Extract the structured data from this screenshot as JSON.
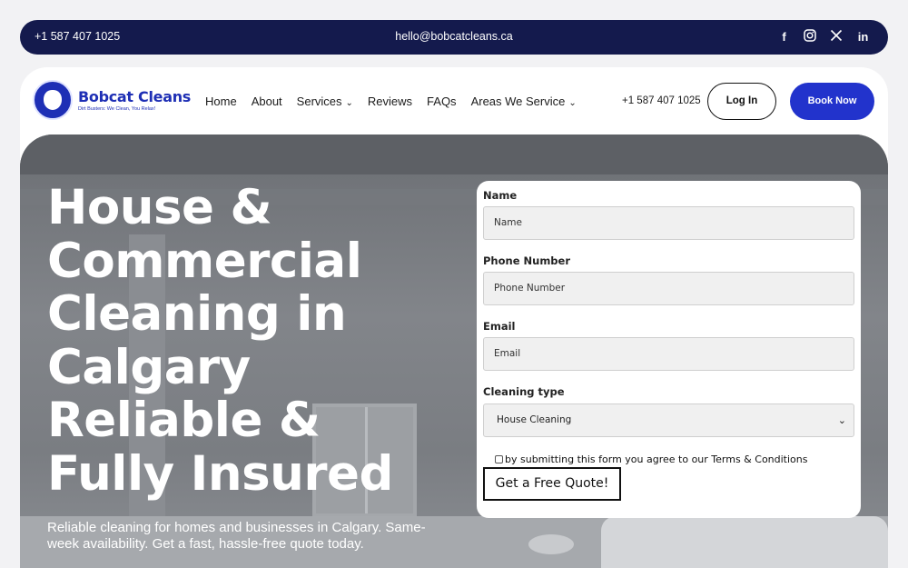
{
  "topbar": {
    "phone": "+1 587 407 1025",
    "email": "hello@bobcatcleans.ca",
    "social": [
      "facebook-icon",
      "instagram-icon",
      "x-icon",
      "linkedin-icon"
    ]
  },
  "header": {
    "logo_name": "Bobcat Cleans",
    "logo_tagline": "Dirt Busters: We Clean, You Relax!",
    "nav": [
      {
        "label": "Home",
        "dropdown": false
      },
      {
        "label": "About",
        "dropdown": false
      },
      {
        "label": "Services",
        "dropdown": true
      },
      {
        "label": "Reviews",
        "dropdown": false
      },
      {
        "label": "FAQs",
        "dropdown": false
      },
      {
        "label": "Areas We Service",
        "dropdown": true
      }
    ],
    "phone": "+1 587 407 1025",
    "login_label": "Log In",
    "book_label": "Book Now"
  },
  "hero": {
    "headline": "House & Commercial Cleaning in Calgary Reliable & Fully Insured",
    "subtitle": "Reliable cleaning for homes and businesses in Calgary. Same-week availability. Get a fast, hassle-free quote today."
  },
  "form": {
    "name_label": "Name",
    "name_placeholder": "Name",
    "phone_label": "Phone Number",
    "phone_placeholder": "Phone Number",
    "email_label": "Email",
    "email_placeholder": "Email",
    "type_label": "Cleaning type",
    "type_value": "House Cleaning",
    "agree_text": "by submitting this form you agree to our Terms & Conditions",
    "submit_label": "Get a Free Quote!"
  },
  "colors": {
    "topbar": "#141a4d",
    "brand": "#2233cc"
  }
}
